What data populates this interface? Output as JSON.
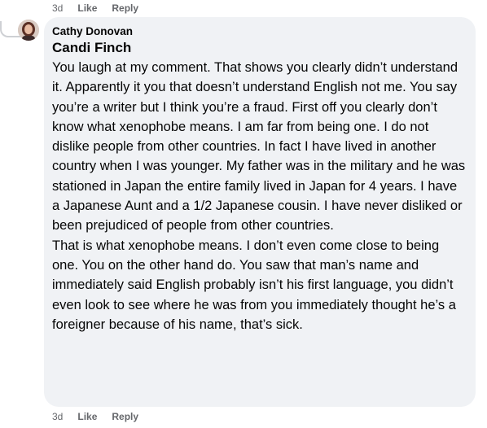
{
  "top_meta": {
    "time": "3d",
    "like": "Like",
    "reply": "Reply"
  },
  "comment": {
    "author": "Cathy Donovan",
    "mention": "Candi Finch",
    "paragraphs": [
      "You laugh at my comment. That shows you clearly didn’t understand it. Apparently it you that doesn’t understand English not me. You say you’re a writer but I think you’re a fraud. First off you clearly don’t know what xenophobe means. I am far from being one. I do not dislike people from other countries. In fact I have lived in another country when I was younger. My father was in the military and he was stationed in Japan the entire family lived in Japan for 4 years. I have a Japanese Aunt and a 1/2 Japanese cousin. I have never disliked or been prejudiced of people from other countries.",
      "That is what xenophobe means. I don’t even come close to being one. You on the other hand do. You saw that man’s name and immediately said English probably isn’t his first language, you didn’t even look to see where he was from you immediately thought he’s a foreigner because of his name, that’s sick."
    ]
  },
  "bottom_meta": {
    "time": "3d",
    "like": "Like",
    "reply": "Reply"
  }
}
